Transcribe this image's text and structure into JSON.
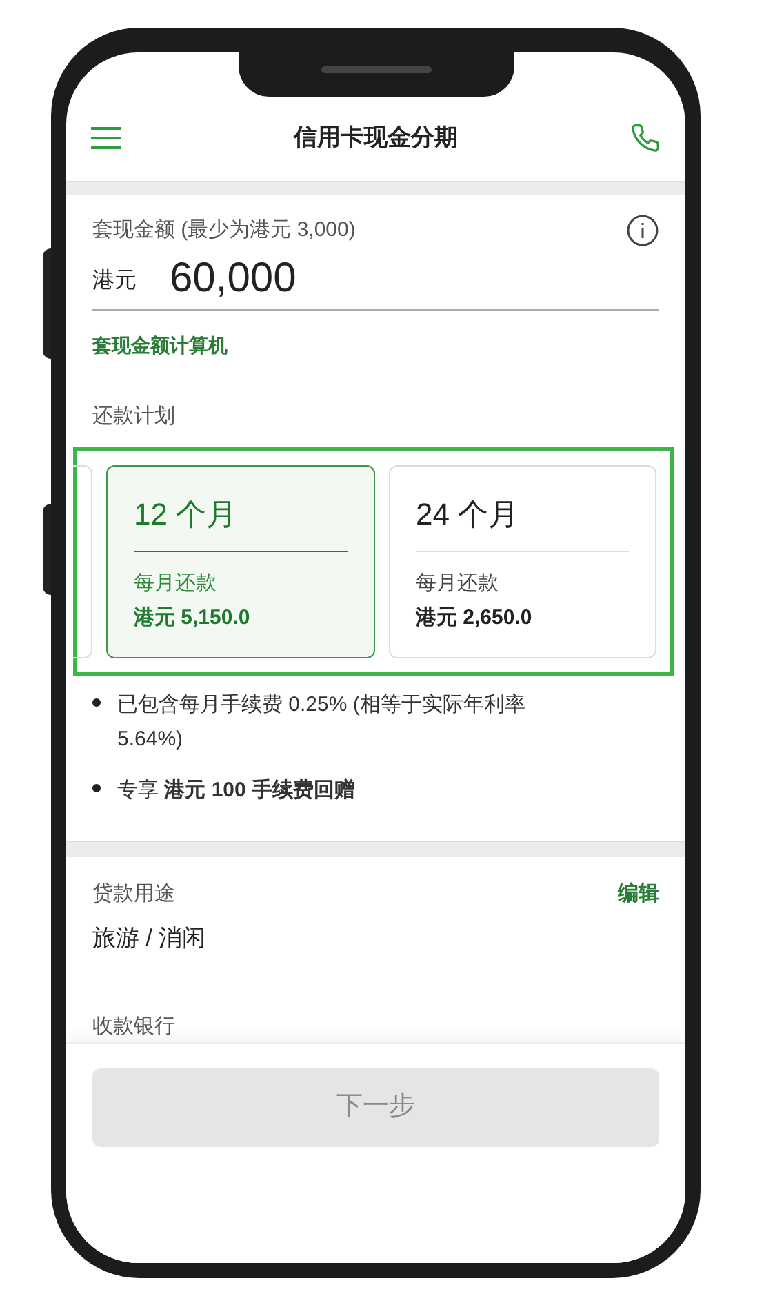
{
  "header": {
    "title": "信用卡现金分期"
  },
  "amount": {
    "label": "套现金额 (最少为港元 3,000)",
    "currency": "港元",
    "value": "60,000",
    "link": "套现金额计算机"
  },
  "plan": {
    "label": "还款计划",
    "options": [
      {
        "term": "12 个月",
        "caption": "每月还款",
        "payment": "港元 5,150.0",
        "selected": true
      },
      {
        "term": "24 个月",
        "caption": "每月还款",
        "payment": "港元 2,650.0",
        "selected": false
      }
    ]
  },
  "notes": [
    "已包含每月手续费 0.25% (相等于实际年利率 5.64%)",
    "专享 **港元 100 手续费回赠**"
  ],
  "purpose": {
    "label": "贷款用途",
    "edit": "编辑",
    "value": "旅游 / 消闲"
  },
  "bank": {
    "label": "收款银行"
  },
  "next_button": {
    "label": "下一步",
    "disabled": true
  }
}
